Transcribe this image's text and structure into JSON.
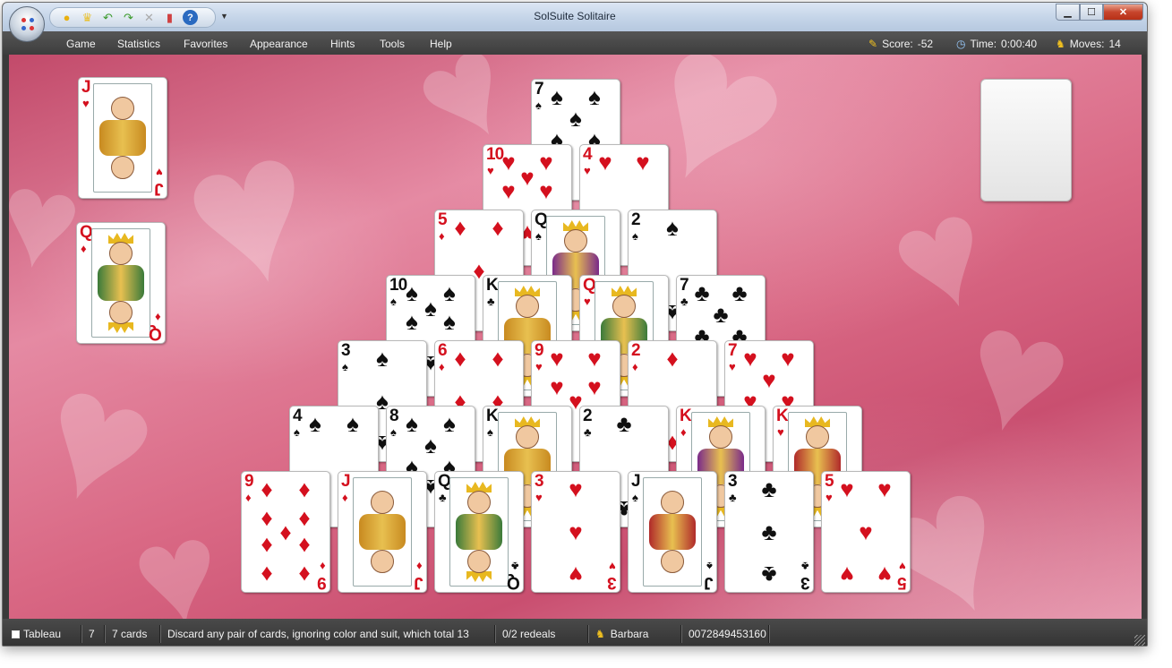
{
  "window": {
    "title": "SolSuite Solitaire"
  },
  "qat": {
    "icons": [
      "new-game-icon",
      "hint-bulb-icon",
      "undo-icon",
      "redo-icon",
      "disabled-icon",
      "statistics-icon",
      "help-icon"
    ]
  },
  "menu": {
    "items": [
      "Game",
      "Statistics",
      "Favorites",
      "Appearance",
      "Hints",
      "Tools",
      "Help"
    ]
  },
  "stats": {
    "score_label": "Score:",
    "score_value": "-52",
    "time_label": "Time:",
    "time_value": "0:00:40",
    "moves_label": "Moves:",
    "moves_value": "14"
  },
  "leftpile": [
    {
      "rank": "J",
      "suit": "♥",
      "color": "red",
      "face": true
    },
    {
      "rank": "Q",
      "suit": "♦",
      "color": "red",
      "face": true
    }
  ],
  "pyramid": [
    [
      {
        "rank": "7",
        "suit": "♠",
        "color": "blk"
      }
    ],
    [
      {
        "rank": "10",
        "suit": "♥",
        "color": "red"
      },
      {
        "rank": "4",
        "suit": "♥",
        "color": "red"
      }
    ],
    [
      {
        "rank": "5",
        "suit": "♦",
        "color": "red"
      },
      {
        "rank": "Q",
        "suit": "♠",
        "color": "blk",
        "face": true
      },
      {
        "rank": "2",
        "suit": "♠",
        "color": "blk"
      }
    ],
    [
      {
        "rank": "10",
        "suit": "♠",
        "color": "blk"
      },
      {
        "rank": "K",
        "suit": "♣",
        "color": "blk",
        "face": true
      },
      {
        "rank": "Q",
        "suit": "♥",
        "color": "red",
        "face": true
      },
      {
        "rank": "7",
        "suit": "♣",
        "color": "blk"
      }
    ],
    [
      {
        "rank": "3",
        "suit": "♠",
        "color": "blk"
      },
      {
        "rank": "6",
        "suit": "♦",
        "color": "red"
      },
      {
        "rank": "9",
        "suit": "♥",
        "color": "red"
      },
      {
        "rank": "2",
        "suit": "♦",
        "color": "red"
      },
      {
        "rank": "7",
        "suit": "♥",
        "color": "red"
      }
    ],
    [
      {
        "rank": "4",
        "suit": "♠",
        "color": "blk"
      },
      {
        "rank": "8",
        "suit": "♠",
        "color": "blk"
      },
      {
        "rank": "K",
        "suit": "♠",
        "color": "blk",
        "face": true
      },
      {
        "rank": "2",
        "suit": "♣",
        "color": "blk"
      },
      {
        "rank": "K",
        "suit": "♦",
        "color": "red",
        "face": true
      },
      {
        "rank": "K",
        "suit": "♥",
        "color": "red",
        "face": true
      }
    ],
    [
      {
        "rank": "9",
        "suit": "♦",
        "color": "red"
      },
      {
        "rank": "J",
        "suit": "♦",
        "color": "red",
        "face": true
      },
      {
        "rank": "Q",
        "suit": "♣",
        "color": "blk",
        "face": true
      },
      {
        "rank": "3",
        "suit": "♥",
        "color": "red"
      },
      {
        "rank": "J",
        "suit": "♠",
        "color": "blk",
        "face": true
      },
      {
        "rank": "3",
        "suit": "♣",
        "color": "blk"
      },
      {
        "rank": "5",
        "suit": "♥",
        "color": "red"
      }
    ]
  ],
  "status": {
    "game_type": "Tableau",
    "count": "7",
    "cards": "7 cards",
    "hint": "Discard any pair of cards, ignoring color and suit, which total 13",
    "redeals": "0/2 redeals",
    "player": "Barbara",
    "game_number": "0072849453160"
  },
  "colors": {
    "felt": "#d96884",
    "menubar": "#3d3d3d",
    "red_suit": "#d4101e"
  }
}
